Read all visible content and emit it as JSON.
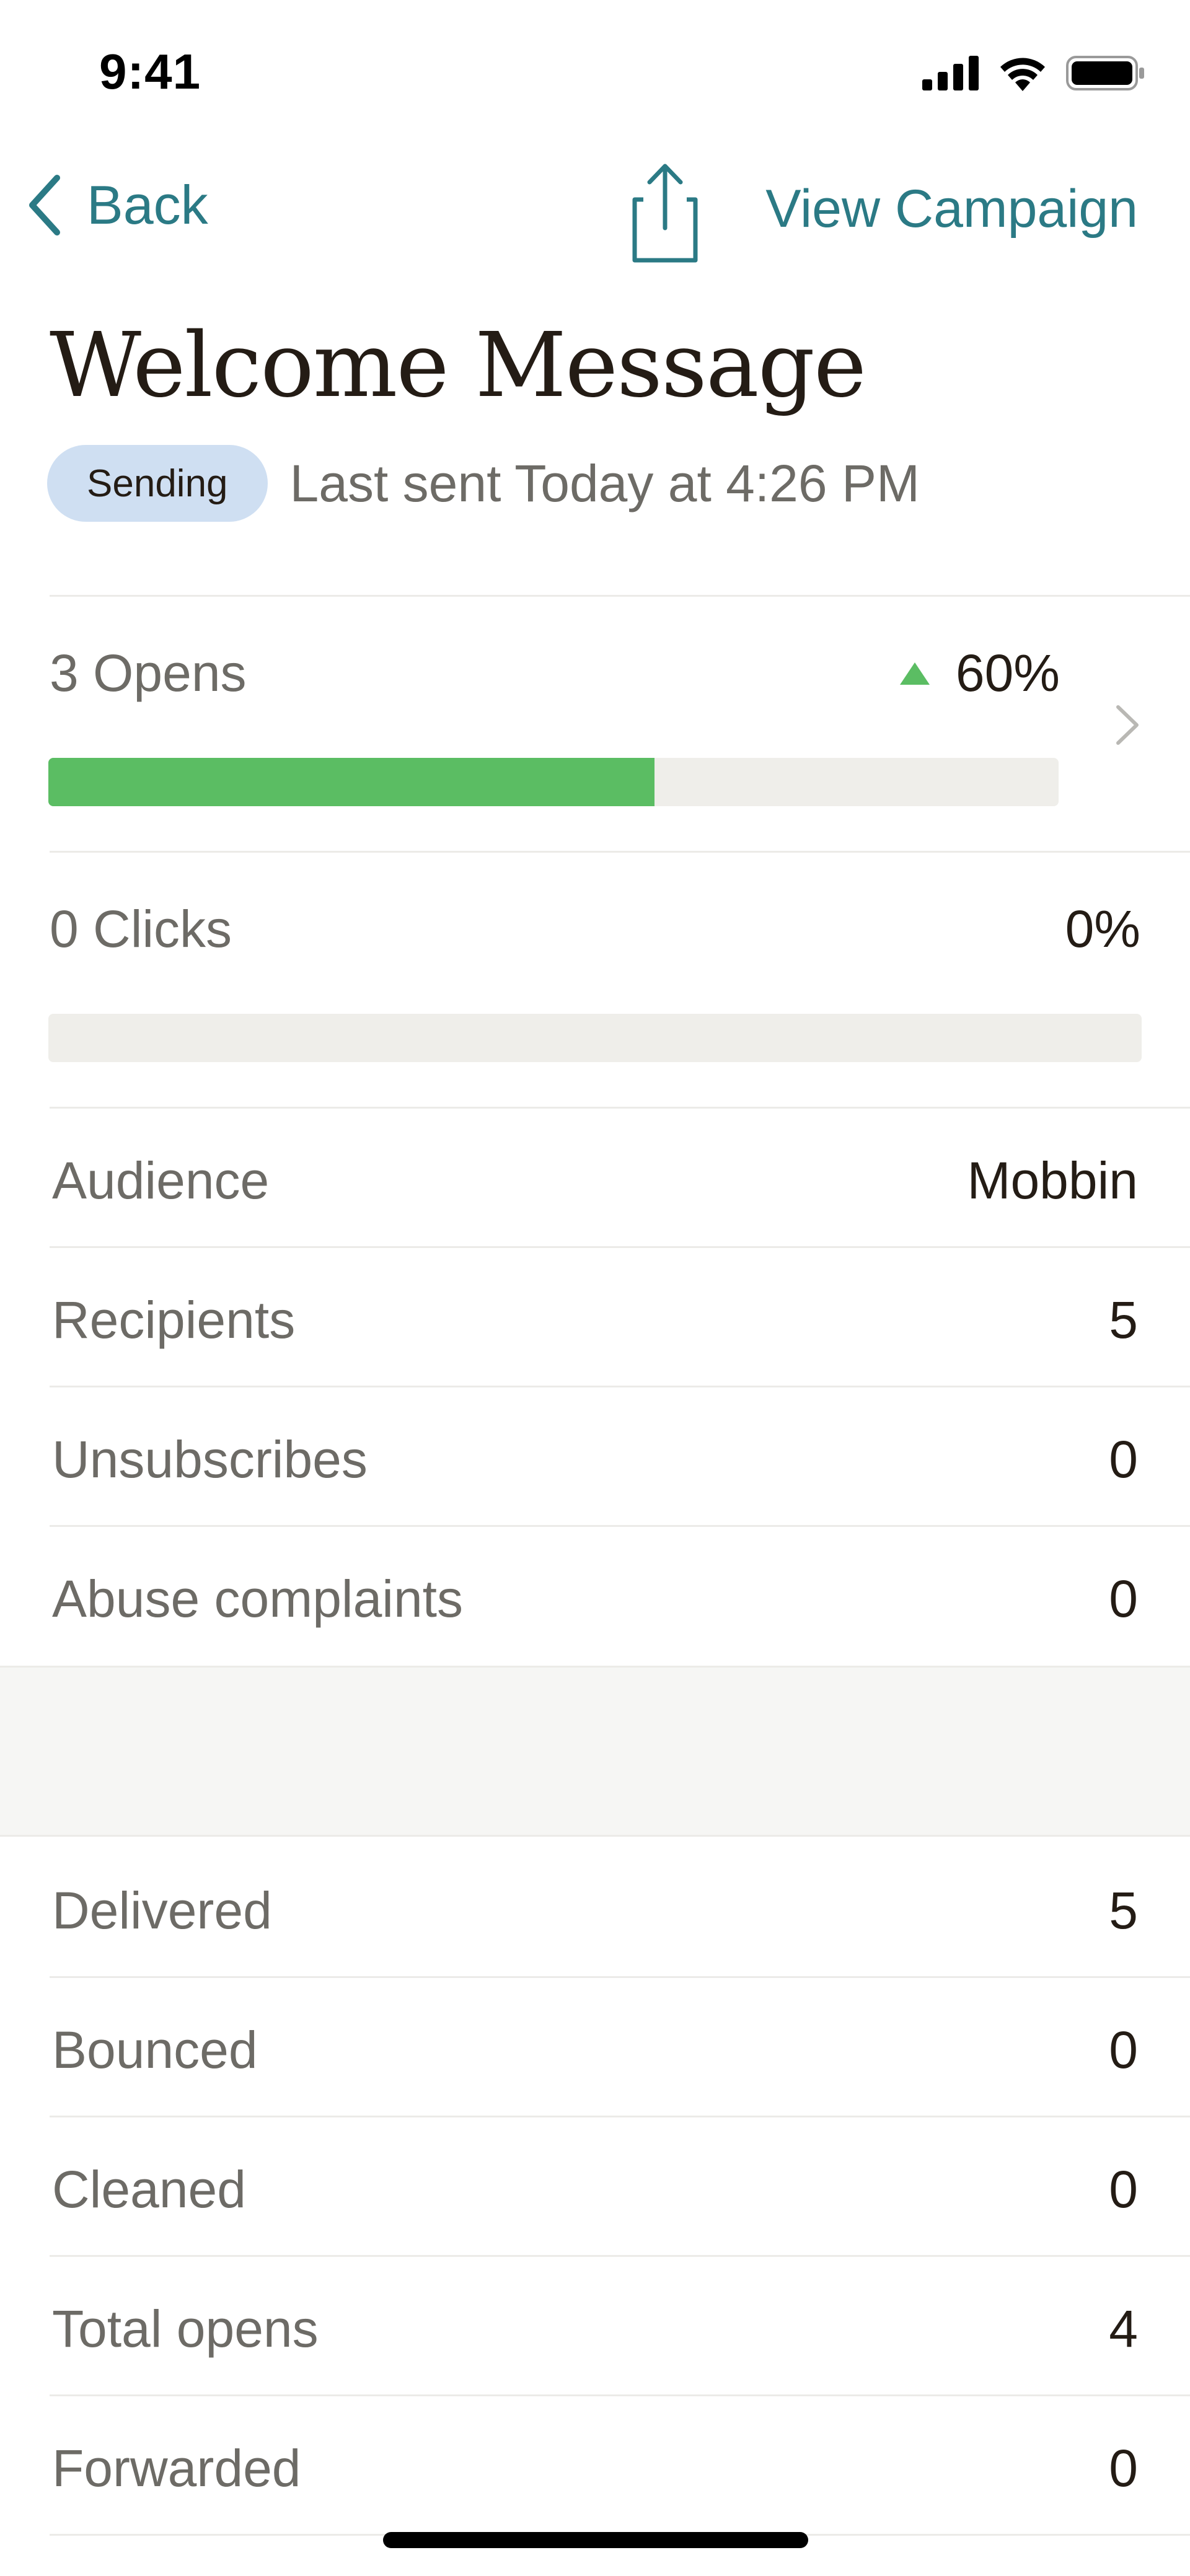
{
  "status_bar": {
    "time": "9:41"
  },
  "nav": {
    "back_label": "Back",
    "view_campaign_label": "View Campaign"
  },
  "header": {
    "title": "Welcome Message",
    "badge": "Sending",
    "last_sent": "Last sent Today at 4:26 PM"
  },
  "opens": {
    "label": "3 Opens",
    "percent": "60%",
    "fill_fraction": 0.6,
    "trend": "up"
  },
  "clicks": {
    "label": "0 Clicks",
    "percent": "0%",
    "fill_fraction": 0
  },
  "stats_primary": [
    {
      "label": "Audience",
      "value": "Mobbin"
    },
    {
      "label": "Recipients",
      "value": "5"
    },
    {
      "label": "Unsubscribes",
      "value": "0"
    },
    {
      "label": "Abuse complaints",
      "value": "0"
    }
  ],
  "stats_secondary": [
    {
      "label": "Delivered",
      "value": "5"
    },
    {
      "label": "Bounced",
      "value": "0"
    },
    {
      "label": "Cleaned",
      "value": "0"
    },
    {
      "label": "Total opens",
      "value": "4"
    },
    {
      "label": "Forwarded",
      "value": "0"
    }
  ],
  "colors": {
    "accent": "#2b7a85",
    "progress_green": "#5bbd63",
    "badge_bg": "#cfdff2",
    "track": "#efeeea"
  }
}
